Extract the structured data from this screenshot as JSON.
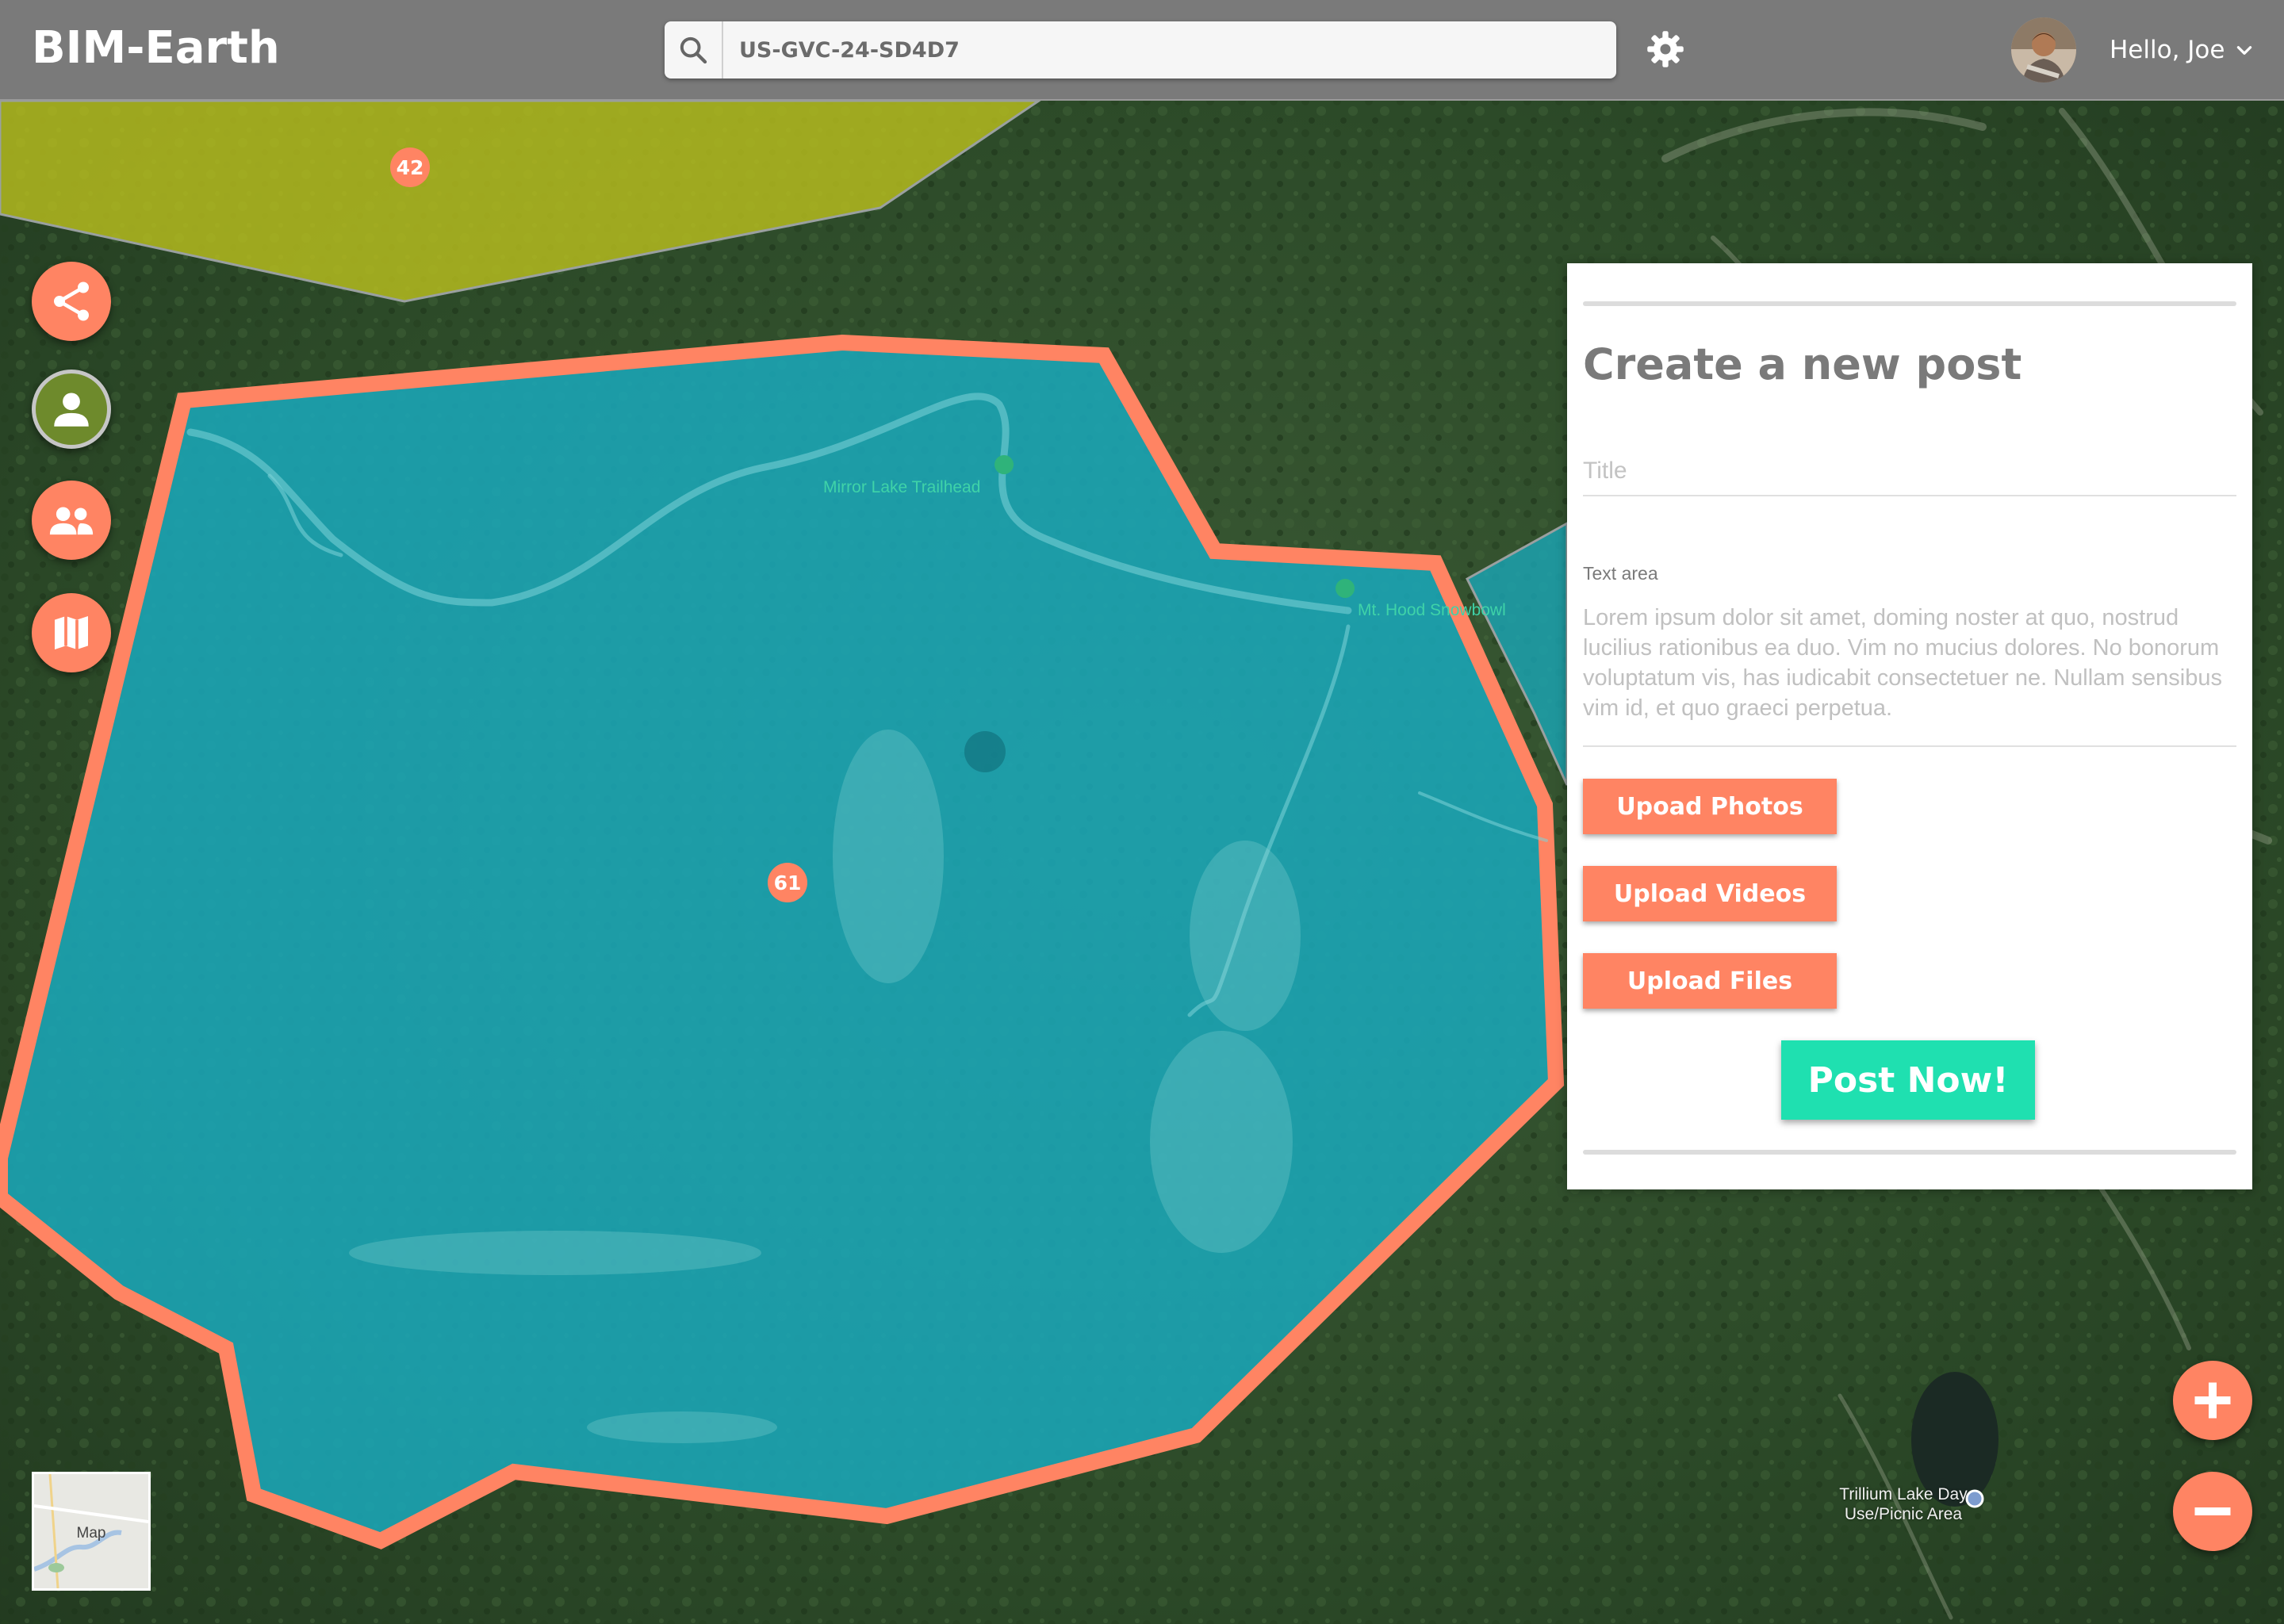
{
  "app": {
    "brand": "BIM-Earth"
  },
  "header": {
    "search_value": "US-GVC-24-SD4D7",
    "search_icon": "search-icon",
    "settings_icon": "gear-icon",
    "greeting": "Hello, Joe",
    "menu_icon": "chevron-down-icon"
  },
  "rail": {
    "share_icon": "share-icon",
    "profile_icon": "user-icon",
    "groups_icon": "users-icon",
    "map_icon": "map-icon"
  },
  "map": {
    "markers": [
      "42",
      "61"
    ],
    "labels": {
      "mirror_lake": "Mirror Lake Trailhead",
      "snowbowl": "Mt. Hood Snowbowl",
      "trillium": [
        "Trillium Lake Day",
        "Use/Picnic Area"
      ]
    },
    "minimap_label": "Map",
    "colors": {
      "selected_fill": "#1aa6b7",
      "selected_outline": "#ff8463",
      "other_fill": "#b8be1e"
    }
  },
  "post_panel": {
    "heading": "Create a new post",
    "title_placeholder": "Title",
    "textarea_label": "Text area",
    "textarea_text": "Lorem ipsum dolor sit amet, doming noster at quo, nostrud lucilius rationibus ea duo. Vim no mucius dolores. No bonorum voluptatum vis, has iudicabit consectetuer ne. Nullam sensibus vim id, et quo graeci perpetua.",
    "upload_photos": "Upoad Photos",
    "upload_videos": "Upload Videos",
    "upload_files": "Upload Files",
    "post_button": "Post Now!"
  },
  "zoom": {
    "in_icon": "plus-icon",
    "out_icon": "minus-icon"
  },
  "colors": {
    "accent": "#ff8463",
    "post_button": "#1fe0b0",
    "header": "#7a7a7a"
  }
}
